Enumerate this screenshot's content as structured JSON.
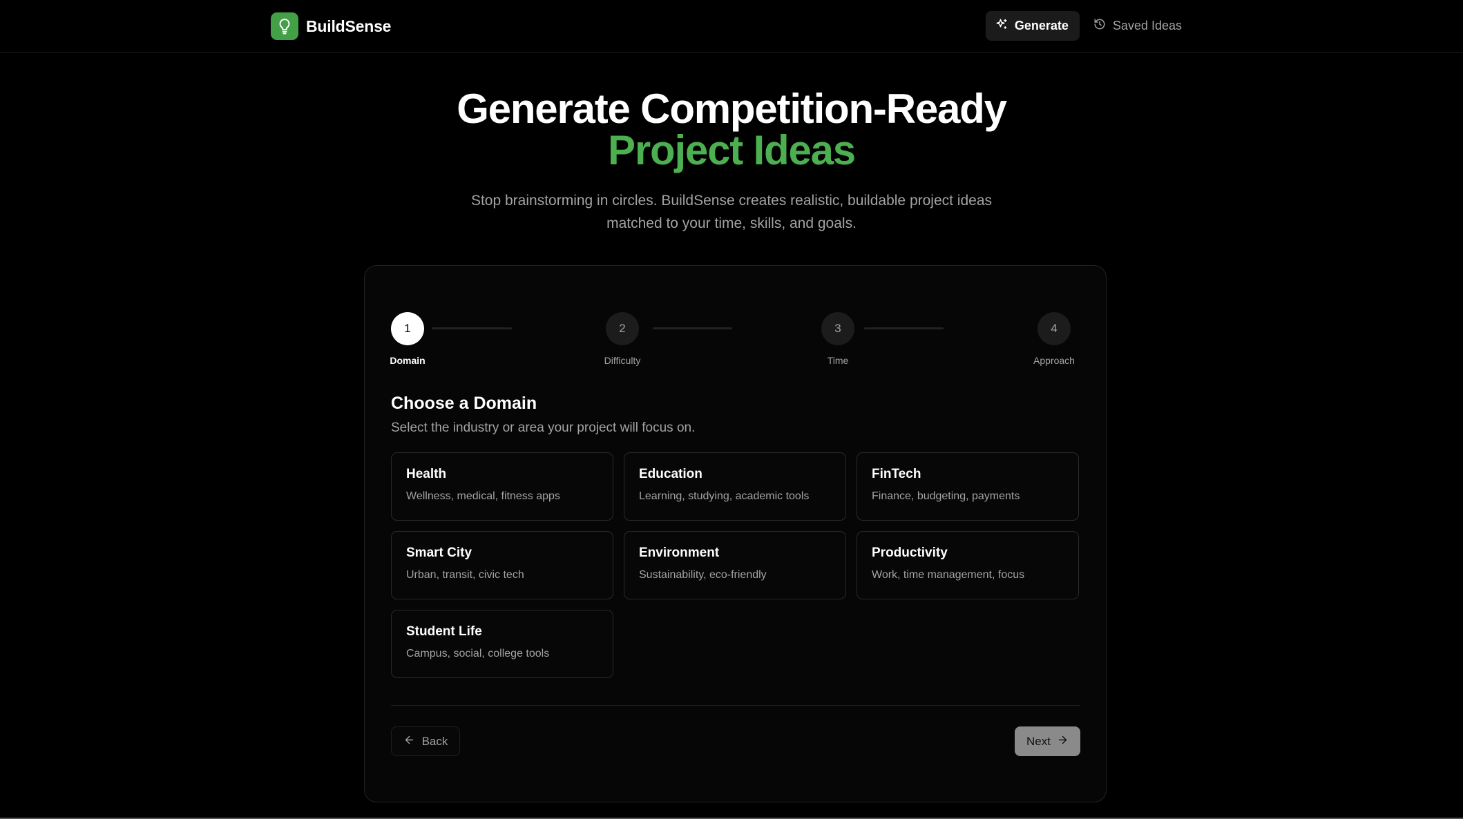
{
  "header": {
    "brand": "BuildSense",
    "nav": [
      {
        "label": "Generate",
        "icon": "sparkles-icon",
        "active": true
      },
      {
        "label": "Saved Ideas",
        "icon": "history-icon",
        "active": false
      }
    ]
  },
  "hero": {
    "title_line1": "Generate Competition-Ready",
    "title_line2": "Project Ideas",
    "subtitle": "Stop brainstorming in circles. BuildSense creates realistic, buildable project ideas matched to your time, skills, and goals."
  },
  "stepper": {
    "current": 1,
    "steps": [
      {
        "number": "1",
        "label": "Domain"
      },
      {
        "number": "2",
        "label": "Difficulty"
      },
      {
        "number": "3",
        "label": "Time"
      },
      {
        "number": "4",
        "label": "Approach"
      }
    ]
  },
  "section": {
    "title": "Choose a Domain",
    "subtitle": "Select the industry or area your project will focus on."
  },
  "domains": [
    {
      "name": "Health",
      "desc": "Wellness, medical, fitness apps"
    },
    {
      "name": "Education",
      "desc": "Learning, studying, academic tools"
    },
    {
      "name": "FinTech",
      "desc": "Finance, budgeting, payments"
    },
    {
      "name": "Smart City",
      "desc": "Urban, transit, civic tech"
    },
    {
      "name": "Environment",
      "desc": "Sustainability, eco-friendly"
    },
    {
      "name": "Productivity",
      "desc": "Work, time management, focus"
    },
    {
      "name": "Student Life",
      "desc": "Campus, social, college tools"
    }
  ],
  "footer_buttons": {
    "back": "Back",
    "next": "Next"
  },
  "colors": {
    "accent": "#4caf50",
    "logo_bg": "#43a047",
    "background": "#000000"
  }
}
